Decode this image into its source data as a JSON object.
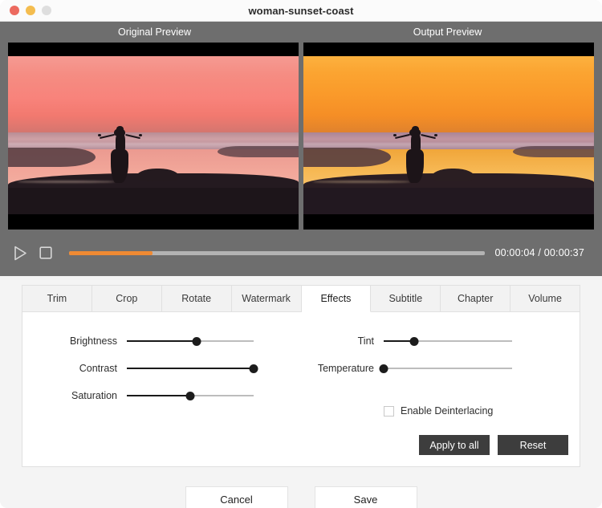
{
  "window": {
    "title": "woman-sunset-coast",
    "traffic_lights": [
      "close-button",
      "minimize-button",
      "zoom-button"
    ]
  },
  "preview": {
    "original_label": "Original Preview",
    "output_label": "Output  Preview"
  },
  "transport": {
    "play_icon": "play-icon",
    "stop_icon": "stop-icon",
    "progress_percent": 20,
    "progress_color": "#ef8a33",
    "current_time": "00:00:04",
    "total_time": "00:00:37",
    "timecode": "00:00:04 / 00:00:37"
  },
  "tabs": [
    {
      "label": "Trim",
      "active": false
    },
    {
      "label": "Crop",
      "active": false
    },
    {
      "label": "Rotate",
      "active": false
    },
    {
      "label": "Watermark",
      "active": false
    },
    {
      "label": "Effects",
      "active": true
    },
    {
      "label": "Subtitle",
      "active": false
    },
    {
      "label": "Chapter",
      "active": false
    },
    {
      "label": "Volume",
      "active": false
    }
  ],
  "effects": {
    "left_sliders": [
      {
        "label": "Brightness",
        "value": 55
      },
      {
        "label": "Contrast",
        "value": 100
      },
      {
        "label": "Saturation",
        "value": 50
      }
    ],
    "right_sliders": [
      {
        "label": "Tint",
        "value": 24
      },
      {
        "label": "Temperature",
        "value": 0
      }
    ],
    "deinterlacing": {
      "label": "Enable Deinterlacing",
      "checked": false
    },
    "apply_to_all_label": "Apply to all",
    "reset_label": "Reset"
  },
  "footer": {
    "cancel_label": "Cancel",
    "save_label": "Save"
  }
}
